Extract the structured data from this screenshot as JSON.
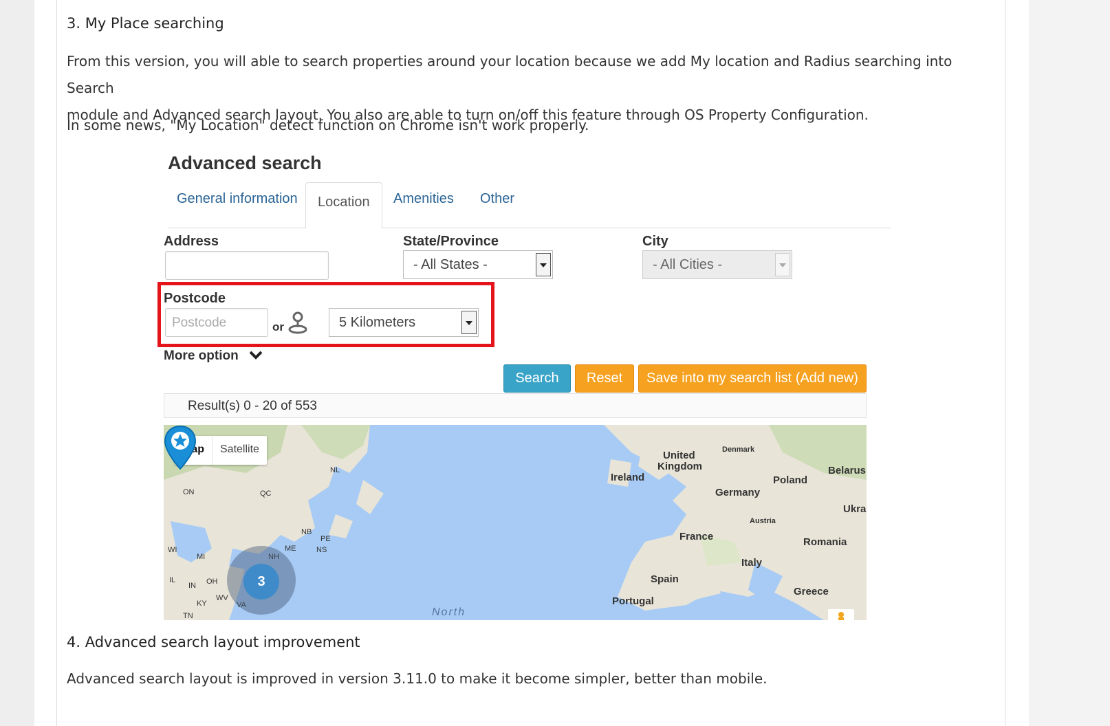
{
  "article": {
    "section3_title": "3. My Place searching",
    "section3_para1_line1": "From this version, you will able to search properties around your location because we add My location and Radius searching into Search",
    "section3_para1_line2": "module and Advanced search layout. You also are able to turn on/off this feature through OS Property Configuration.",
    "section3_para2": "In some news, \"My Location\" detect function on Chrome isn't work properly.",
    "section4_title": "4. Advanced search layout improvement",
    "section4_para": "Advanced search layout is improved in version 3.11.0 to make it become simpler, better than mobile."
  },
  "search_form": {
    "title": "Advanced search",
    "tabs": [
      {
        "label": "General information",
        "active": false
      },
      {
        "label": "Location",
        "active": true
      },
      {
        "label": "Amenities",
        "active": false
      },
      {
        "label": "Other",
        "active": false
      }
    ],
    "address_label": "Address",
    "address_value": "",
    "state_label": "State/Province",
    "state_value": "- All States -",
    "city_label": "City",
    "city_value": "- All Cities -",
    "postcode_label": "Postcode",
    "postcode_placeholder": "Postcode",
    "or_text": "or",
    "radius_value": "5 Kilometers",
    "more_option_label": "More option",
    "buttons": {
      "search": "Search",
      "reset": "Reset",
      "save": "Save into my search list (Add new)"
    },
    "results_text": "Result(s) 0 - 20 of 553"
  },
  "map": {
    "type_map": "Map",
    "type_satellite": "Satellite",
    "cluster_count": "3",
    "ocean_label": "North",
    "labels": {
      "ireland": "Ireland",
      "united": "United",
      "kingdom": "Kingdom",
      "denmark": "Denmark",
      "poland": "Poland",
      "belarus": "Belarus",
      "germany": "Germany",
      "ukra": "Ukra",
      "austria": "Austria",
      "france": "France",
      "romania": "Romania",
      "italy": "Italy",
      "spain": "Spain",
      "greece": "Greece",
      "portugal": "Portugal",
      "on": "ON",
      "qc": "QC",
      "nl": "NL",
      "nb": "NB",
      "pe": "PE",
      "ns": "NS",
      "me": "ME",
      "nh": "NH",
      "wi": "WI",
      "mi": "MI",
      "il": "IL",
      "in": "IN",
      "oh": "OH",
      "ky": "KY",
      "wv": "WV",
      "va": "VA",
      "tn": "TN"
    }
  },
  "colors": {
    "highlight": "#e5141a",
    "search_button": "#3aa4c8",
    "orange_button": "#f6a11f",
    "tab_link": "#2a6496",
    "water": "#a7cbf5",
    "land": "#e8e4d8"
  }
}
